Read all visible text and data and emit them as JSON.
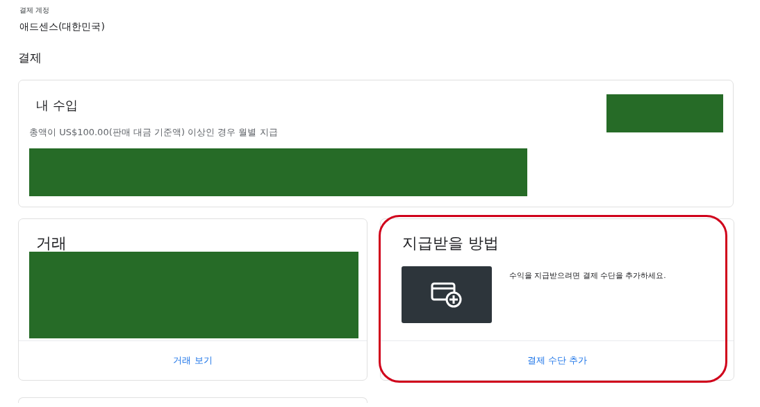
{
  "account": {
    "label": "결제 계정",
    "value": "애드센스(대한민국)"
  },
  "section_title": "결제",
  "earnings": {
    "title": "내 수입",
    "subtitle": "총액이 US$100.00(판매 대금 기준액) 이상인 경우 월별 지급"
  },
  "transactions": {
    "title": "거래",
    "link": "거래 보기"
  },
  "payment_method": {
    "title": "지급받을 방법",
    "message": "수익을 지급받으려면 결제 수단을 추가하세요.",
    "link": "결제 수단 추가",
    "highlighted": true
  }
}
